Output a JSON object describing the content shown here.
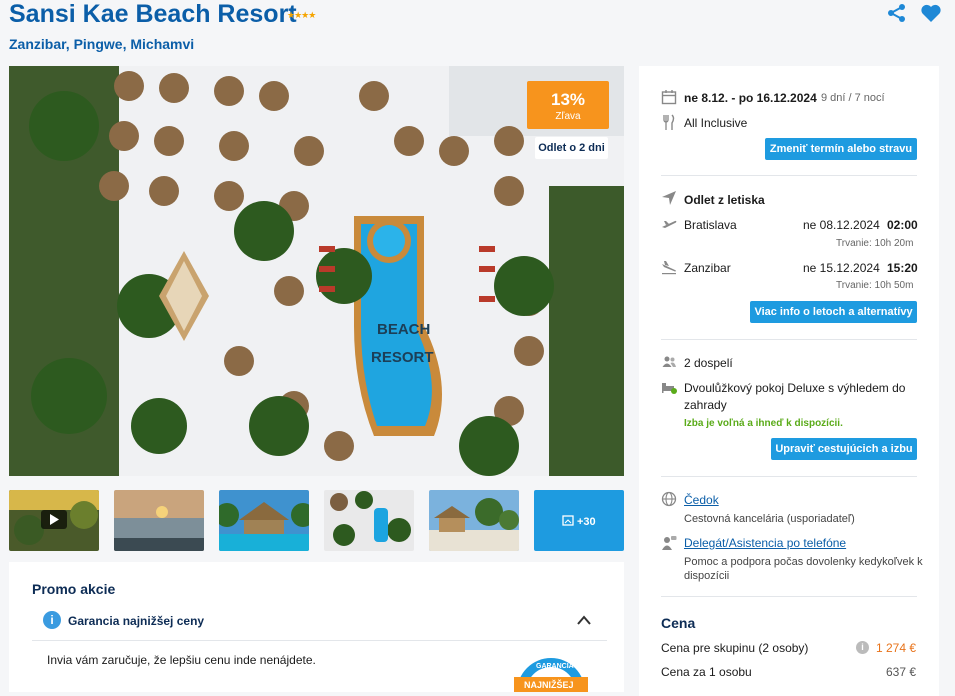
{
  "header": {
    "title": "Sansi Kae Beach Resort",
    "stars": "★★★★",
    "location": "Zanzibar, Pingwe, Michamvi"
  },
  "hero": {
    "discount_percent": "13%",
    "discount_label": "Zľava",
    "departure_badge": "Odlet o 2 dni",
    "pool_text_1": "BEACH",
    "pool_text_2": "RESORT"
  },
  "gallery": {
    "more_count": "+30"
  },
  "promo": {
    "title": "Promo akcie",
    "guarantee_title": "Garancia najnižšej ceny",
    "guarantee_text": "Invia vám zaručuje, že lepšiu cenu inde nenájdete.",
    "badge_text_1": "GARANCIA",
    "badge_text_2": "NAJNIŽŠEJ"
  },
  "sidebar": {
    "dates": "ne 8.12. - po 16.12.2024",
    "duration": "9 dní / 7 nocí",
    "board": "All Inclusive",
    "change_button": "Zmeniť termín alebo stravu",
    "flights_heading": "Odlet z letiska",
    "flights": [
      {
        "from": "Bratislava",
        "date": "ne 08.12.2024",
        "time": "02:00",
        "duration": "Trvanie: 10h 20m"
      },
      {
        "from": "Zanzibar",
        "date": "ne 15.12.2024",
        "time": "15:20",
        "duration": "Trvanie: 10h 50m"
      }
    ],
    "flights_button": "Viac info o letoch a alternatívy",
    "travelers": "2 dospelí",
    "room_line1": "Dvoulůžkový pokoj Deluxe s výhledem do",
    "room_line2": "zahrady",
    "room_status": "Izba je voľná a ihneď k dispozícii.",
    "room_button": "Upraviť cestujúcich a izbu",
    "agency_name": "Čedok",
    "agency_desc": "Cestovná kancelária (usporiadateľ)",
    "assist_name": "Delegát/Asistencia po telefóne",
    "assist_desc_1": "Pomoc a podpora počas dovolenky kedykoľvek k",
    "assist_desc_2": "dispozícii",
    "price_heading": "Cena",
    "price_group_label": "Cena pre skupinu (2 osoby)",
    "price_group_value": "1 274 €",
    "price_person_label": "Cena za 1 osobu",
    "price_person_value": "637 €"
  },
  "colors": {
    "brand_blue": "#0b5ea8",
    "button_blue": "#1e9be0",
    "discount_orange": "#f7941d",
    "available_green": "#5aab19",
    "price_orange": "#e8731a"
  }
}
